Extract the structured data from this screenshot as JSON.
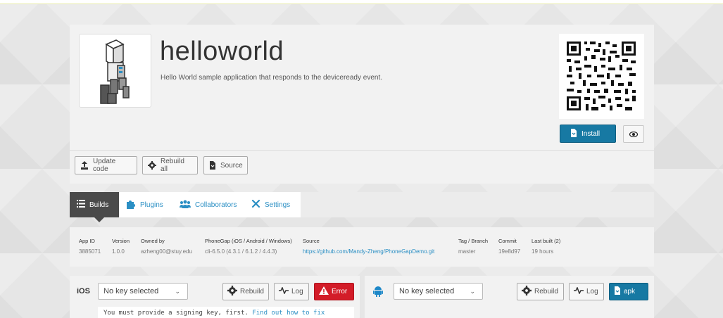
{
  "app": {
    "title": "helloworld",
    "description": "Hello World sample application that responds to the deviceready event.",
    "install_label": "Install"
  },
  "actions": {
    "update_code": "Update code",
    "rebuild_all": "Rebuild all",
    "source": "Source"
  },
  "tabs": [
    {
      "label": "Builds",
      "icon": "list-icon"
    },
    {
      "label": "Plugins",
      "icon": "puzzle-icon"
    },
    {
      "label": "Collaborators",
      "icon": "people-icon"
    },
    {
      "label": "Settings",
      "icon": "wrench-icon"
    }
  ],
  "info": {
    "app_id": {
      "label": "App ID",
      "value": "3885071"
    },
    "version": {
      "label": "Version",
      "value": "1.0.0"
    },
    "owned_by": {
      "label": "Owned by",
      "value": "azheng00@stuy.edu"
    },
    "phonegap": {
      "label": "PhoneGap (iOS / Android / Windows)",
      "value": "cli-6.5.0 (4.3.1 / 6.1.2 / 4.4.3)"
    },
    "source": {
      "label": "Source",
      "value": "https://github.com/Mandy-Zheng/PhoneGapDemo.git"
    },
    "tag_branch": {
      "label": "Tag / Branch",
      "value": "master"
    },
    "commit": {
      "label": "Commit",
      "value": "19e8d97"
    },
    "last_built": {
      "label": "Last built (2)",
      "value": "19 hours"
    }
  },
  "ios": {
    "label": "iOS",
    "key_select": "No key selected",
    "rebuild": "Rebuild",
    "log": "Log",
    "error": "Error",
    "message": "You must provide a signing key, first.",
    "message_link": "Find out how to fix"
  },
  "android": {
    "key_select": "No key selected",
    "rebuild": "Rebuild",
    "log": "Log",
    "apk": "apk"
  },
  "colors": {
    "accent": "#1779a3",
    "link": "#2b8fc4",
    "error": "#d31c28",
    "android_green": "#1e88c8"
  }
}
